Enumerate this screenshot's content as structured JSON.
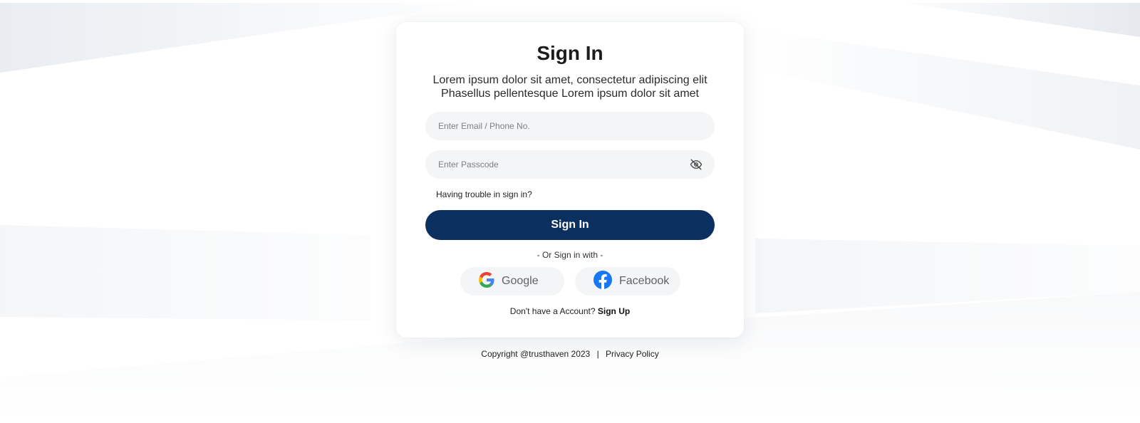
{
  "colors": {
    "primary_button": "#0b3060",
    "field_background": "#f4f5f6",
    "card_background": "#ffffff"
  },
  "card": {
    "title": "Sign In",
    "subtitle": "Lorem ipsum dolor sit amet, consectetur adipiscing elit Phasellus pellentesque Lorem ipsum dolor sit amet"
  },
  "form": {
    "email_placeholder": "Enter Email / Phone No.",
    "email_value": "",
    "passcode_placeholder": "Enter Passcode",
    "passcode_value": "",
    "passcode_toggle_icon": "eye-off-icon",
    "trouble_link": "Having trouble in sign in?",
    "signin_button": "Sign In"
  },
  "social": {
    "divider_text": "- Or Sign in with -",
    "google_label": "Google",
    "google_icon": "google-icon",
    "facebook_label": "Facebook",
    "facebook_icon": "facebook-icon"
  },
  "signup": {
    "prompt": "Don't have a Account?",
    "link": "Sign Up"
  },
  "footer": {
    "copyright": "Copyright @trusthaven 2023",
    "separator": "|",
    "privacy": "Privacy Policy"
  }
}
